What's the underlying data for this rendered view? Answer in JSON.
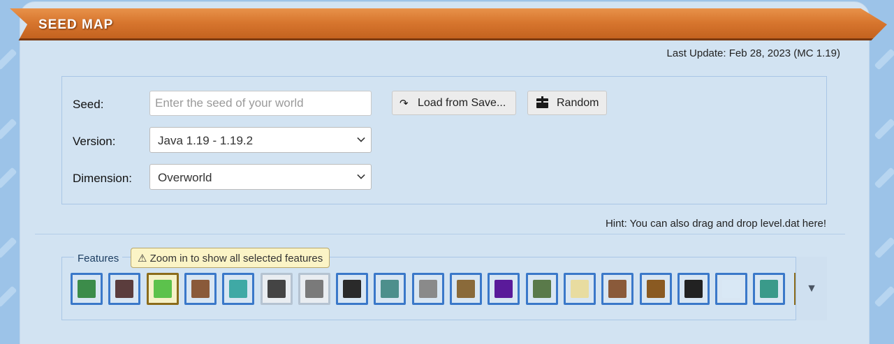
{
  "header": {
    "title": "SEED MAP"
  },
  "last_update": "Last Update: Feb 28, 2023 (MC 1.19)",
  "form": {
    "seed_label": "Seed:",
    "seed_placeholder": "Enter the seed of your world",
    "seed_value": "",
    "version_label": "Version:",
    "version_value": "Java 1.19 - 1.19.2",
    "dimension_label": "Dimension:",
    "dimension_value": "Overworld",
    "load_button": "Load from Save...",
    "random_button": "Random"
  },
  "hint": "Hint: You can also drag and drop level.dat here!",
  "features": {
    "label": "Features",
    "zoom_tip": "⚠ Zoom in to show all selected features",
    "more_symbol": "▼",
    "items": [
      {
        "icon": "biome-map-icon",
        "state": "on",
        "color": "#3c8c4a"
      },
      {
        "icon": "buried-treasure-icon",
        "state": "on",
        "color": "#5b3d3d"
      },
      {
        "icon": "slime-chunk-icon",
        "state": "selected",
        "color": "#5cc24c"
      },
      {
        "icon": "village-icon",
        "state": "on",
        "color": "#8a5a3a"
      },
      {
        "icon": "lantern-icon",
        "state": "on",
        "color": "#3fa9a5"
      },
      {
        "icon": "spawner-icon",
        "state": "off",
        "color": "#444444"
      },
      {
        "icon": "stronghold-eye-icon",
        "state": "off",
        "color": "#7a7a7a"
      },
      {
        "icon": "witch-hut-icon",
        "state": "on",
        "color": "#2a2a2a"
      },
      {
        "icon": "ocean-monument-icon",
        "state": "on",
        "color": "#4d8f8c"
      },
      {
        "icon": "pillager-outpost-icon",
        "state": "on",
        "color": "#8a8a8a"
      },
      {
        "icon": "mineshaft-icon",
        "state": "on",
        "color": "#8a6a3a"
      },
      {
        "icon": "ruined-portal-icon",
        "state": "on",
        "color": "#5a1a9a"
      },
      {
        "icon": "jungle-temple-icon",
        "state": "on",
        "color": "#5a7a4a"
      },
      {
        "icon": "desert-temple-icon",
        "state": "on",
        "color": "#e8dca0"
      },
      {
        "icon": "woodland-mansion-icon",
        "state": "on",
        "color": "#8a5a3a"
      },
      {
        "icon": "chest-icon",
        "state": "on",
        "color": "#8a5a22"
      },
      {
        "icon": "anchor-icon",
        "state": "on",
        "color": "#222222"
      },
      {
        "icon": "snowball-icon",
        "state": "on",
        "color": "#d9e8f5"
      },
      {
        "icon": "drowned-icon",
        "state": "on",
        "color": "#3a9a8a"
      }
    ]
  }
}
